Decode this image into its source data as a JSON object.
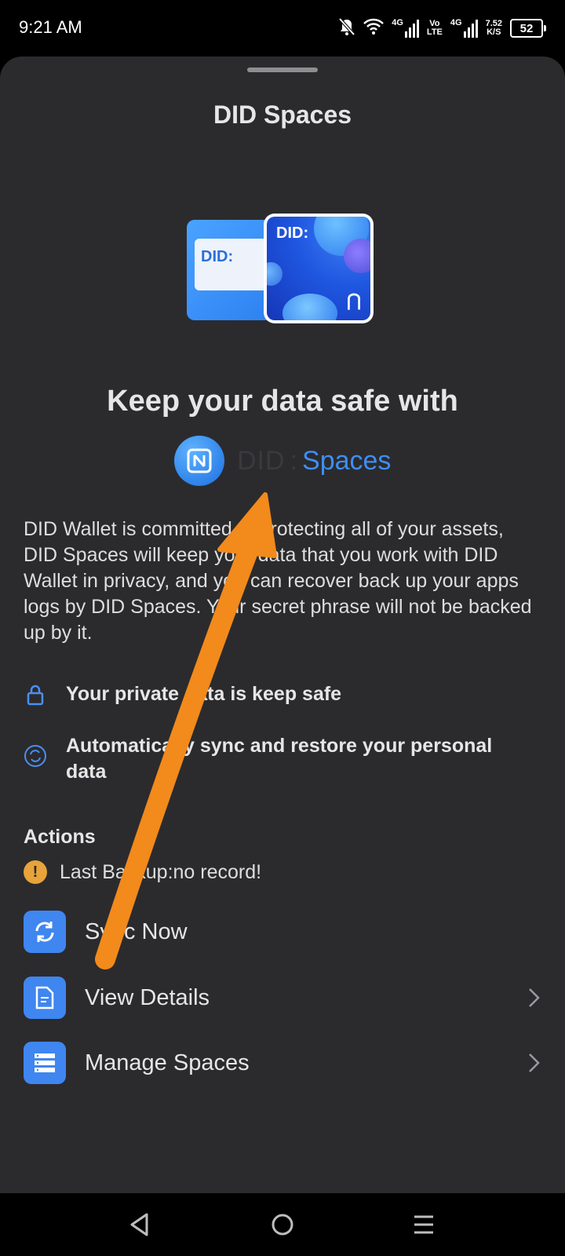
{
  "status_bar": {
    "time": "9:21 AM",
    "net1": "4G",
    "volte_top": "Vo",
    "volte_bottom": "LTE",
    "net2": "4G",
    "speed_value": "7.52",
    "speed_unit": "K/S",
    "battery": "52"
  },
  "sheet": {
    "title": "DID Spaces",
    "hero_back_label": "DID:",
    "hero_front_label": "DID:",
    "headline": "Keep your data safe with",
    "brand": {
      "did": "DID",
      "sep": ":",
      "spaces": "Spaces"
    },
    "description": "DID Wallet is committed to protecting all of your assets, DID Spaces will keep your data that you work with DID Wallet in privacy, and you can recover back up your apps logs by DID Spaces. Your secret phrase will not be backed up by it.",
    "features": [
      {
        "icon": "lock-icon",
        "text": "Your private data is keep safe"
      },
      {
        "icon": "sync-circle-icon",
        "text": "Automatically sync and restore your personal data"
      }
    ],
    "actions_heading": "Actions",
    "last_backup": "Last Backup:no record!",
    "actions": [
      {
        "icon": "sync-icon",
        "label": "Sync Now"
      },
      {
        "icon": "document-icon",
        "label": "View Details"
      },
      {
        "icon": "storage-icon",
        "label": "Manage Spaces"
      }
    ]
  },
  "colors": {
    "sheet_bg": "#2b2b2d",
    "accent": "#3f86f0",
    "warning": "#e8a33a",
    "annotation_arrow": "#f28a1c"
  }
}
